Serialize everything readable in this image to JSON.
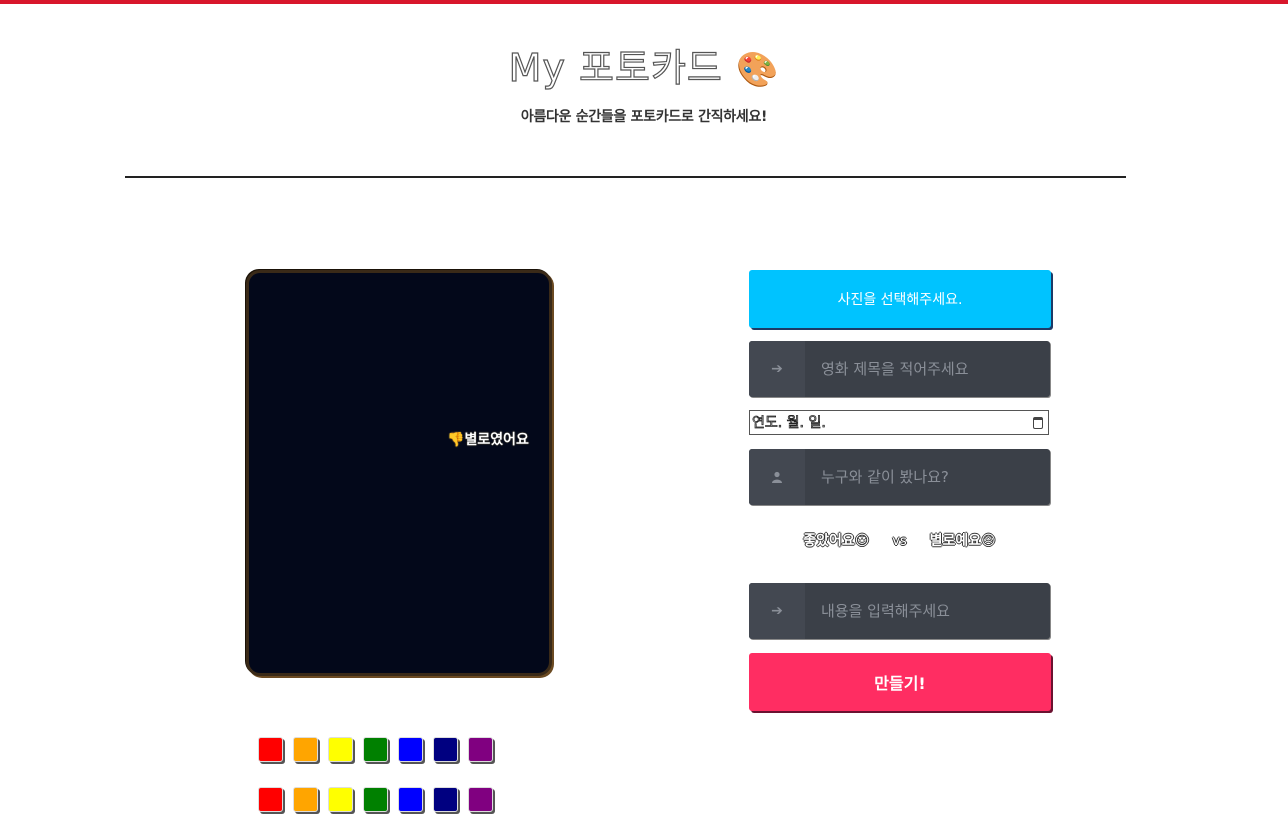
{
  "header": {
    "title": "My 포토카드",
    "title_emoji": "🎨",
    "subtitle": "아름다운 순간들을 포토카드로 간직하세요!"
  },
  "card": {
    "background_color": "#03081a",
    "badge_emoji": "👎",
    "badge_text": "별로였어요"
  },
  "swatches": [
    {
      "row": 1,
      "colors": [
        "#ff0000",
        "#ffa500",
        "#ffff00",
        "#008000",
        "#0000ff",
        "#000080",
        "#800080"
      ]
    },
    {
      "row": 2,
      "colors": [
        "#ff0000",
        "#ffa500",
        "#ffff00",
        "#008000",
        "#0000ff",
        "#000080",
        "#800080"
      ]
    }
  ],
  "form": {
    "photo_button_label": "사진을 선택해주세요.",
    "title_placeholder": "영화 제목을 적어주세요",
    "title_icon": "arrow-right-icon",
    "date_placeholder": "연도. 월. 일.",
    "date_icon": "calendar-icon",
    "companion_placeholder": "누구와 같이 봤나요?",
    "companion_icon": "user-icon",
    "like_option": "좋았어요😍",
    "vs_label": "vs",
    "dislike_option": "별로예요😥",
    "content_placeholder": "내용을 입력해주세요",
    "content_icon": "arrow-right-icon",
    "submit_label": "만들기!"
  },
  "colors": {
    "accent_top_bar": "#d8162b",
    "photo_button": "#00c3ff",
    "submit_button": "#ff2d62",
    "field_bg": "#3b4048"
  }
}
